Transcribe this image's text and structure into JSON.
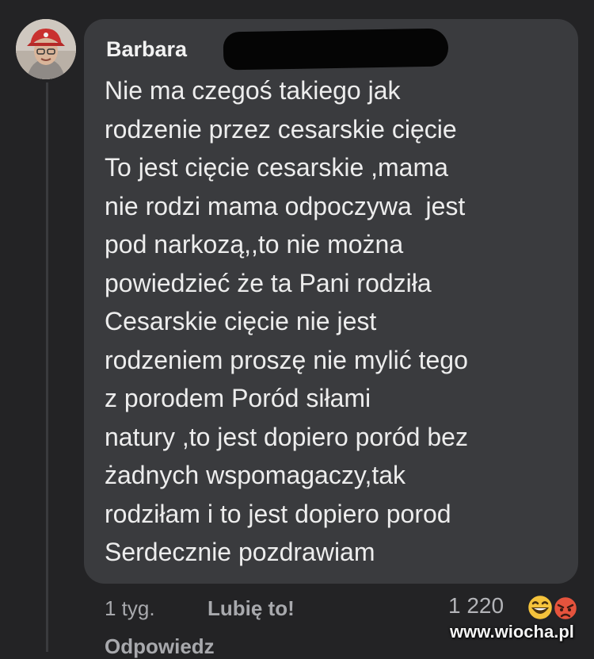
{
  "comment": {
    "author": "Barbara",
    "lines": [
      "Nie ma czegoś takiego jak",
      "rodzenie przez cesarskie cięcie",
      "To jest cięcie cesarskie ,mama",
      "nie rodzi mama odpoczywa  jest",
      "pod narkozą,,to nie można",
      "powiedzieć że ta Pani rodziła",
      "Cesarskie cięcie nie jest",
      "rodzeniem proszę nie mylić tego",
      "z porodem Poród siłami",
      "natury ,to jest dopiero poród bez",
      "żadnych wspomagaczy,tak",
      "rodziłam i to jest dopiero porod",
      "Serdecznie pozdrawiam"
    ]
  },
  "meta": {
    "time": "1 tyg.",
    "like_label": "Lubię to!",
    "reply_label": "Odpowiedz",
    "reaction_count": "1 220",
    "reactions": [
      "laughing-emoji",
      "angry-emoji"
    ]
  },
  "watermark": "www.wiocha.pl",
  "colors": {
    "background": "#232325",
    "bubble": "#3a3b3e",
    "text": "#ededed",
    "meta_text": "#a8a9ad",
    "laugh_emoji": "#f5c33b",
    "angry_emoji": "#e5533d"
  }
}
